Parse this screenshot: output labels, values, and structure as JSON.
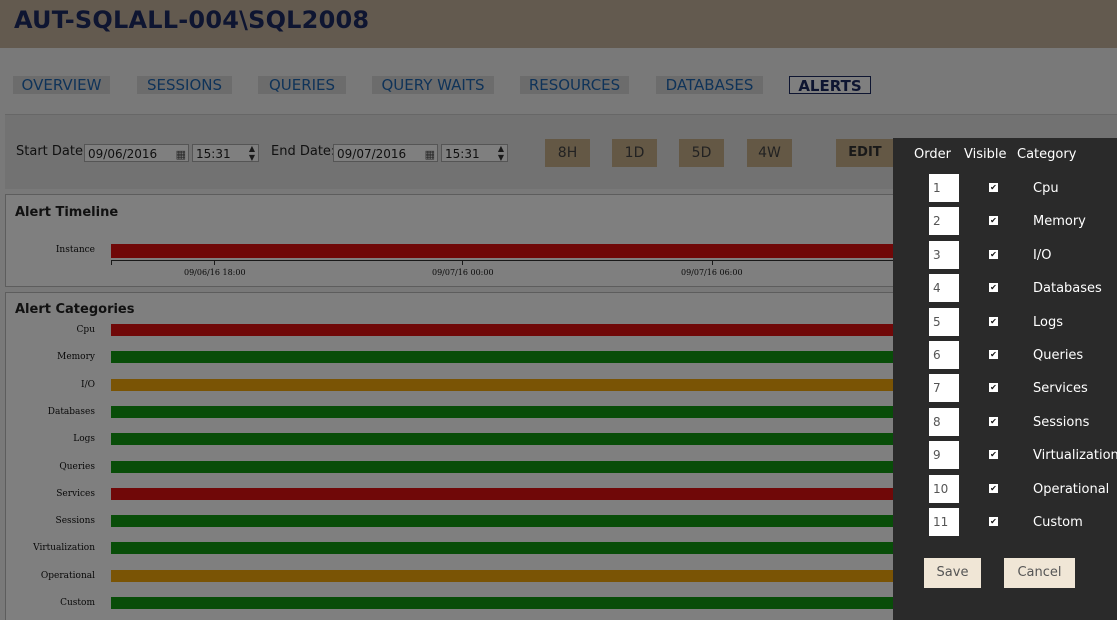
{
  "header": {
    "server": "AUT-SQLALL-004\\SQL2008"
  },
  "tabs": [
    "OVERVIEW",
    "SESSIONS",
    "QUERIES",
    "QUERY WAITS",
    "RESOURCES",
    "DATABASES",
    "ALERTS"
  ],
  "active_tab": "ALERTS",
  "filters": {
    "start_label": "Start Date:",
    "start_date": "09/06/2016",
    "start_time": "15:31",
    "end_label": "End Date:",
    "end_date": "09/07/2016",
    "end_time": "15:31",
    "ranges": [
      "8H",
      "1D",
      "5D",
      "4W"
    ],
    "edit_label": "EDIT"
  },
  "timeline": {
    "title": "Alert Timeline",
    "row_label": "Instance",
    "status": "critical",
    "tick_labels": [
      "09/06/16 18:00",
      "09/07/16 00:00",
      "09/07/16 06:00"
    ]
  },
  "categories_panel": {
    "title": "Alert Categories",
    "rows": [
      {
        "label": "Cpu",
        "status": "critical"
      },
      {
        "label": "Memory",
        "status": "ok"
      },
      {
        "label": "I/O",
        "status": "warning"
      },
      {
        "label": "Databases",
        "status": "ok"
      },
      {
        "label": "Logs",
        "status": "ok"
      },
      {
        "label": "Queries",
        "status": "ok"
      },
      {
        "label": "Services",
        "status": "critical"
      },
      {
        "label": "Sessions",
        "status": "ok"
      },
      {
        "label": "Virtualization",
        "status": "ok"
      },
      {
        "label": "Operational",
        "status": "warning"
      },
      {
        "label": "Custom",
        "status": "ok"
      }
    ]
  },
  "status_colors": {
    "critical": "#e01010",
    "ok": "#119a11",
    "warning": "#f5a80a"
  },
  "edit_panel": {
    "headers": {
      "order": "Order",
      "visible": "Visible",
      "category": "Category"
    },
    "rows": [
      {
        "order": "1",
        "visible": true,
        "category": "Cpu"
      },
      {
        "order": "2",
        "visible": true,
        "category": "Memory"
      },
      {
        "order": "3",
        "visible": true,
        "category": "I/O"
      },
      {
        "order": "4",
        "visible": true,
        "category": "Databases"
      },
      {
        "order": "5",
        "visible": true,
        "category": "Logs"
      },
      {
        "order": "6",
        "visible": true,
        "category": "Queries"
      },
      {
        "order": "7",
        "visible": true,
        "category": "Services"
      },
      {
        "order": "8",
        "visible": true,
        "category": "Sessions"
      },
      {
        "order": "9",
        "visible": true,
        "category": "Virtualization"
      },
      {
        "order": "10",
        "visible": true,
        "category": "Operational"
      },
      {
        "order": "11",
        "visible": true,
        "category": "Custom"
      }
    ],
    "save_label": "Save",
    "cancel_label": "Cancel"
  }
}
